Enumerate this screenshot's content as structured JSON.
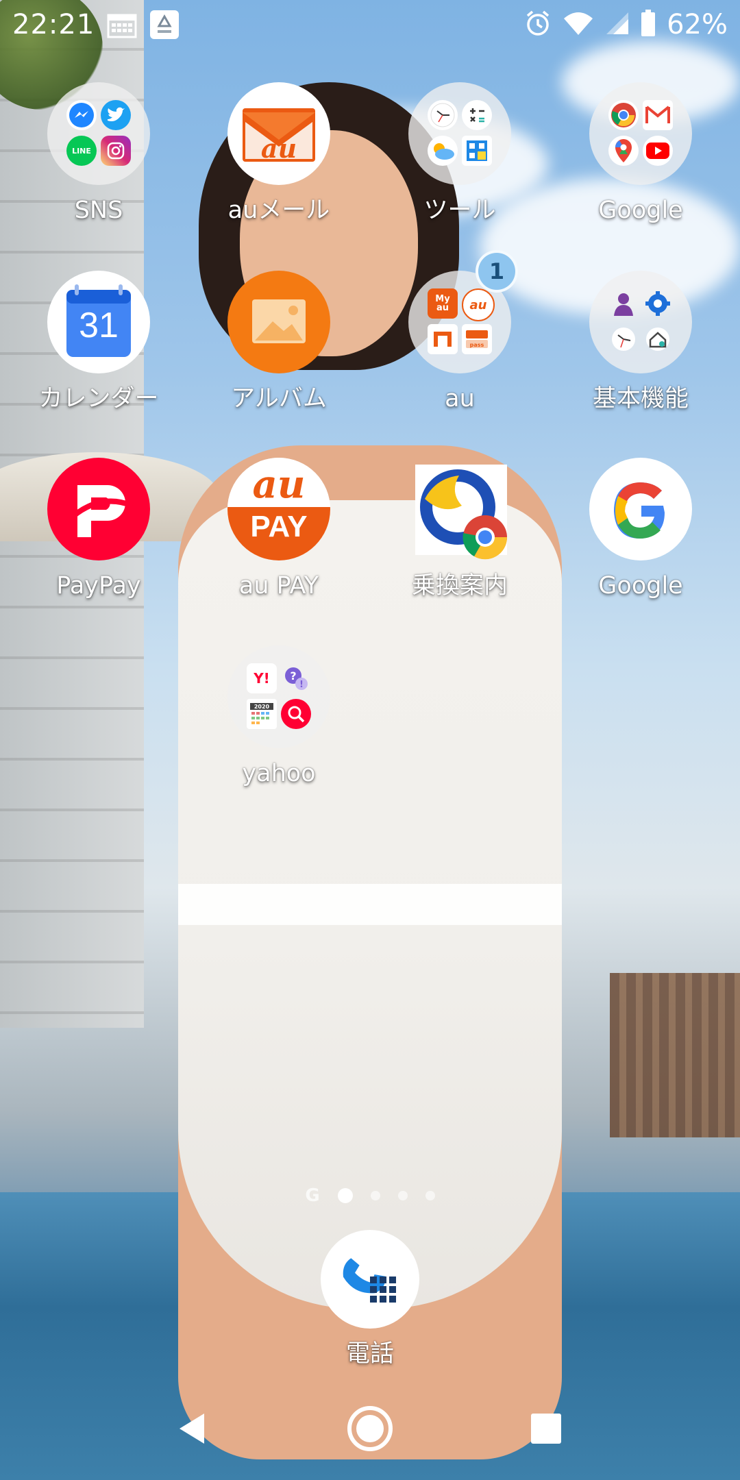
{
  "status_bar": {
    "time": "22:21",
    "icons_left": [
      "calendar-notification-icon",
      "app-notification-icon"
    ],
    "icons_right": [
      "alarm-icon",
      "wifi-icon",
      "signal-icon",
      "battery-icon"
    ],
    "battery_percent": "62%"
  },
  "apps": [
    {
      "id": "sns",
      "label": "SNS",
      "type": "folder",
      "contents": [
        "messenger-icon",
        "twitter-icon",
        "line-icon",
        "instagram-icon"
      ]
    },
    {
      "id": "au-mail",
      "label": "auメール",
      "type": "app"
    },
    {
      "id": "tools",
      "label": "ツール",
      "type": "folder",
      "contents": [
        "clock-icon",
        "calculator-icon",
        "weather-icon",
        "qr-reader-icon"
      ]
    },
    {
      "id": "google-folder",
      "label": "Google",
      "type": "folder",
      "contents": [
        "chrome-icon",
        "gmail-icon",
        "maps-icon",
        "youtube-icon"
      ]
    },
    {
      "id": "calendar",
      "label": "カレンダー",
      "type": "app",
      "day": "31"
    },
    {
      "id": "album",
      "label": "アルバム",
      "type": "app"
    },
    {
      "id": "au-folder",
      "label": "au",
      "type": "folder",
      "badge": "1",
      "contents": [
        "my-au-icon",
        "au-wallet-icon",
        "au-pay-market-icon",
        "pass-icon"
      ]
    },
    {
      "id": "basic-functions",
      "label": "基本機能",
      "type": "folder",
      "contents": [
        "contacts-icon",
        "settings-icon",
        "clock-icon",
        "smart-home-icon"
      ]
    },
    {
      "id": "paypay",
      "label": "PayPay",
      "type": "app"
    },
    {
      "id": "au-pay",
      "label": "au PAY",
      "type": "app",
      "logo_top": "au",
      "logo_bottom": "PAY"
    },
    {
      "id": "transit",
      "label": "乗換案内",
      "type": "app"
    },
    {
      "id": "google",
      "label": "Google",
      "type": "app"
    },
    {
      "id": "yahoo",
      "label": "yahoo",
      "type": "folder",
      "contents": [
        "yahoo-japan-icon",
        "chiebukuro-icon",
        "calendar-2020-icon",
        "yahoo-search-icon"
      ]
    }
  ],
  "page_indicator": {
    "g_label": "G",
    "pages": 4,
    "active_index": 0
  },
  "dock": {
    "phone_label": "電話"
  },
  "navigation": [
    "back-button",
    "home-button",
    "recents-button"
  ],
  "colors": {
    "au_orange": "#eb5a12",
    "paypay_red": "#ff0033",
    "google_blue": "#4285f4",
    "badge_blue": "#8ec5ef"
  }
}
